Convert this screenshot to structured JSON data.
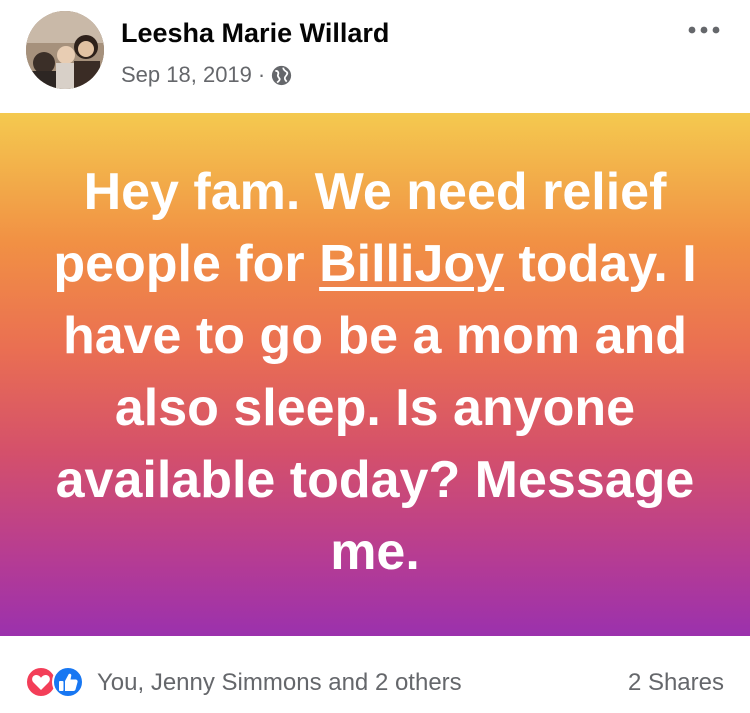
{
  "post": {
    "author": "Leesha Marie Willard",
    "date": "Sep 18, 2019",
    "separator": "·",
    "privacy_icon": "globe-icon",
    "more_icon": "more-options-icon",
    "text_before_mention": "Hey fam. We need relief people for ",
    "mention": "BilliJoy",
    "text_after_mention": " today. I have to go be a mom and also sleep.  Is anyone available today? Message me.",
    "background_gradient": [
      "#f4c94f",
      "#f19044",
      "#ea6f52",
      "#d4506b",
      "#b63c93",
      "#9b31ad"
    ]
  },
  "footer": {
    "reaction_icons": [
      "love-reaction-icon",
      "like-reaction-icon"
    ],
    "reactions_text": "You, Jenny Simmons and 2 others",
    "shares_text": "2 Shares"
  },
  "colors": {
    "love": "#f33e58",
    "like": "#1877f2",
    "secondary_text": "#65676b"
  }
}
